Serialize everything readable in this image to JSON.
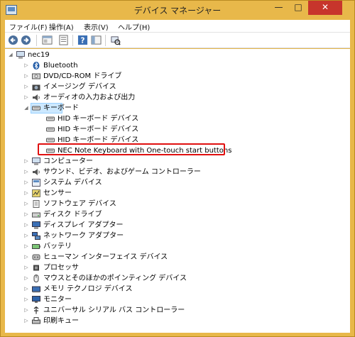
{
  "window": {
    "title": "デバイス マネージャー",
    "minimize": "—",
    "maximize": "□",
    "close": "✕"
  },
  "menu": [
    "ファイル(F)",
    "操作(A)",
    "表示(V)",
    "ヘルプ(H)"
  ],
  "toolbar": {
    "back_icon": "back-arrow-icon",
    "forward_icon": "forward-arrow-icon",
    "properties_icon": "properties-icon",
    "show_hidden_icon": "show-hidden-icon",
    "help_icon": "help-icon",
    "panel_icon": "panel-icon",
    "scan_icon": "scan-hardware-icon"
  },
  "tree": {
    "root": "nec19",
    "categories": [
      "Bluetooth",
      "DVD/CD-ROM ドライブ",
      "イメージング デバイス",
      "オーディオの入力および出力",
      "キーボード",
      "コンピューター",
      "サウンド、ビデオ、およびゲーム コントローラー",
      "システム デバイス",
      "センサー",
      "ソフトウェア デバイス",
      "ディスク ドライブ",
      "ディスプレイ アダプター",
      "ネットワーク アダプター",
      "バッテリ",
      "ヒューマン インターフェイス デバイス",
      "プロセッサ",
      "マウスとそのほかのポインティング デバイス",
      "メモリ テクノロジ デバイス",
      "モニター",
      "ユニバーサル シリアル バス コントローラー",
      "印刷キュー"
    ],
    "keyboard_children": [
      "HID キーボード デバイス",
      "HID キーボード デバイス",
      "HID キーボード デバイス",
      "NEC Note Keyboard with One-touch start buttons"
    ],
    "expanded_glyph": "◢",
    "collapsed_glyph": "▷"
  },
  "colors": {
    "titlebar": "#e8b84a",
    "close_button": "#c7352c",
    "selection": "#cce8ff",
    "highlight_box": "#e01010"
  }
}
